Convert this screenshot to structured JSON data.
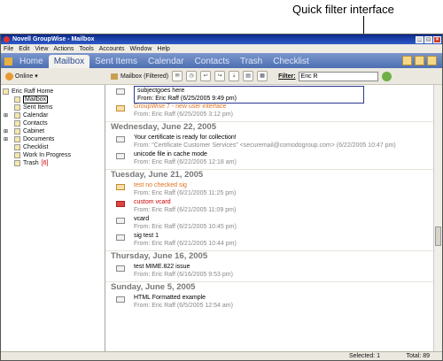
{
  "callout": {
    "text": "Quick filter interface"
  },
  "window": {
    "title": "Novell GroupWise - Mailbox"
  },
  "menu": [
    "File",
    "Edit",
    "View",
    "Actions",
    "Tools",
    "Accounts",
    "Window",
    "Help"
  ],
  "nav_tabs": [
    "Home",
    "Mailbox",
    "Sent Items",
    "Calendar",
    "Contacts",
    "Trash",
    "Checklist"
  ],
  "toolbar": {
    "online": "Online",
    "folder": "Mailbox (Filtered)",
    "filter_label": "Filter:",
    "filter_value": "Eric R"
  },
  "sidebar": {
    "root": "Eric Raff Home",
    "items": [
      {
        "label": "Mailbox"
      },
      {
        "label": "Sent Items"
      },
      {
        "label": "Calendar"
      },
      {
        "label": "Contacts"
      },
      {
        "label": "Cabinet"
      },
      {
        "label": "Documents"
      },
      {
        "label": "Checklist"
      },
      {
        "label": "Work In Progress"
      },
      {
        "label": "Trash",
        "count": "[6]"
      }
    ]
  },
  "messages_top": [
    {
      "subject": "subjectgoes here",
      "from": "From: Eric Raff (6/25/2005 9:49 pm)"
    },
    {
      "subject": "GroupWise 7 - new user interface",
      "from": "From: Eric Raff (6/25/2005 3:12 pm)"
    }
  ],
  "days": [
    {
      "label": "Wednesday, June 22, 2005",
      "messages": [
        {
          "subject": "Your certificate is ready for collection!",
          "from": "From: \"Certificate Customer Services\" <securemail@comodogroup.com> (6/22/2005 10:47 pm)"
        },
        {
          "subject": "unicode file in cache mode",
          "from": "From: Eric Raff (6/22/2005 12:18 am)"
        }
      ]
    },
    {
      "label": "Tuesday, June 21, 2005",
      "messages": [
        {
          "subject": "test no checked sig",
          "from": "From: Eric Raff (6/21/2005 11:25 pm)"
        },
        {
          "subject": "custom vcard",
          "from": "From: Eric Raff (6/21/2005 11:09 pm)"
        },
        {
          "subject": "vcard",
          "from": "From: Eric Raff (6/21/2005 10:45 pm)"
        },
        {
          "subject": "sig test 1",
          "from": "From: Eric Raff (6/21/2005 10:44 pm)"
        }
      ]
    },
    {
      "label": "Thursday, June 16, 2005",
      "messages": [
        {
          "subject": "test MIME.822 issue",
          "from": "From: Eric Raff (6/16/2005 9:53 pm)"
        }
      ]
    },
    {
      "label": "Sunday, June 5, 2005",
      "messages": [
        {
          "subject": "HTML Formatted example",
          "from": "From: Eric Raff (6/5/2005 12:54 am)"
        }
      ]
    }
  ],
  "status": {
    "selected": "Selected: 1",
    "total": "Total: 89"
  }
}
